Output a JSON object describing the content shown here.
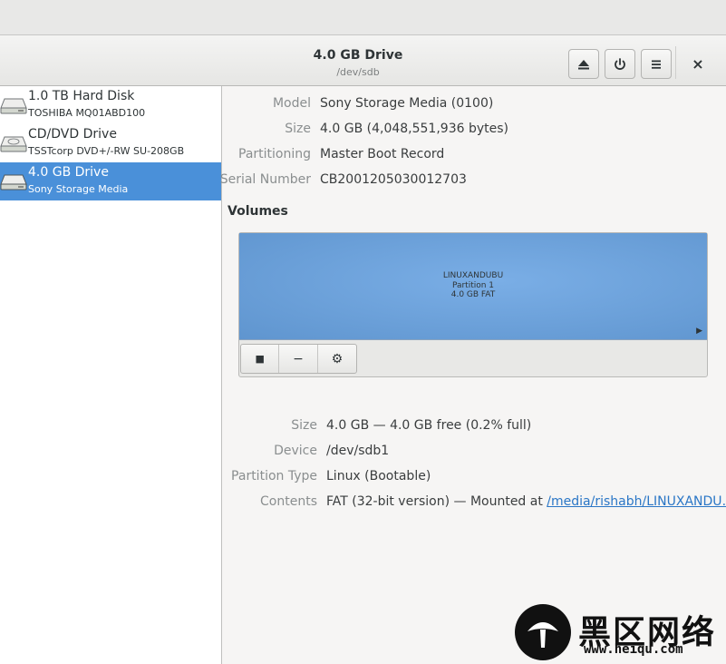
{
  "header": {
    "title": "4.0 GB Drive",
    "subtitle": "/dev/sdb",
    "buttons": [
      {
        "icon": "eject-icon"
      },
      {
        "icon": "power-icon"
      },
      {
        "icon": "menu-icon"
      }
    ],
    "close_icon": "close-icon",
    "close_glyph": "×"
  },
  "sidebar": {
    "items": [
      {
        "name": "1.0 TB Hard Disk",
        "detail": "TOSHIBA MQ01ABD100",
        "icon": "hard-disk-icon",
        "selected": false
      },
      {
        "name": "CD/DVD Drive",
        "detail": "TSSTcorp DVD+/-RW SU-208GB",
        "icon": "optical-drive-icon",
        "selected": false
      },
      {
        "name": "4.0 GB Drive",
        "detail": "Sony Storage Media",
        "icon": "usb-drive-icon",
        "selected": true
      }
    ]
  },
  "drive": {
    "properties": [
      {
        "label": "Model",
        "value": "Sony Storage Media (0100)"
      },
      {
        "label": "Size",
        "value": "4.0 GB (4,048,551,936 bytes)"
      },
      {
        "label": "Partitioning",
        "value": "Master Boot Record"
      },
      {
        "label": "Serial Number",
        "value": "CB2001205030012703"
      }
    ]
  },
  "volumes": {
    "heading": "Volumes",
    "partition": {
      "label": "LINUXANDUBU",
      "name": "Partition 1",
      "size_fs": "4.0 GB FAT",
      "color": "#6ea4dc",
      "arrow": "▶"
    },
    "toolbar": [
      {
        "icon": "stop-icon",
        "glyph": "■"
      },
      {
        "icon": "minus-icon",
        "glyph": "−"
      },
      {
        "icon": "gears-icon",
        "glyph": "⚙"
      }
    ],
    "details": [
      {
        "label": "Size",
        "value": "4.0 GB — 4.0 GB free (0.2% full)"
      },
      {
        "label": "Device",
        "value": "/dev/sdb1"
      },
      {
        "label": "Partition Type",
        "value": "Linux (Bootable)"
      },
      {
        "label": "Contents",
        "value": "FAT (32-bit version) — Mounted at ",
        "link": "/media/rishabh/LINUXANDU…"
      }
    ]
  },
  "watermark": {
    "text_cn": "黑区网络",
    "url": "www.heiqu.com"
  },
  "colors": {
    "selection": "#4a90d9",
    "link": "#2a76c6"
  }
}
